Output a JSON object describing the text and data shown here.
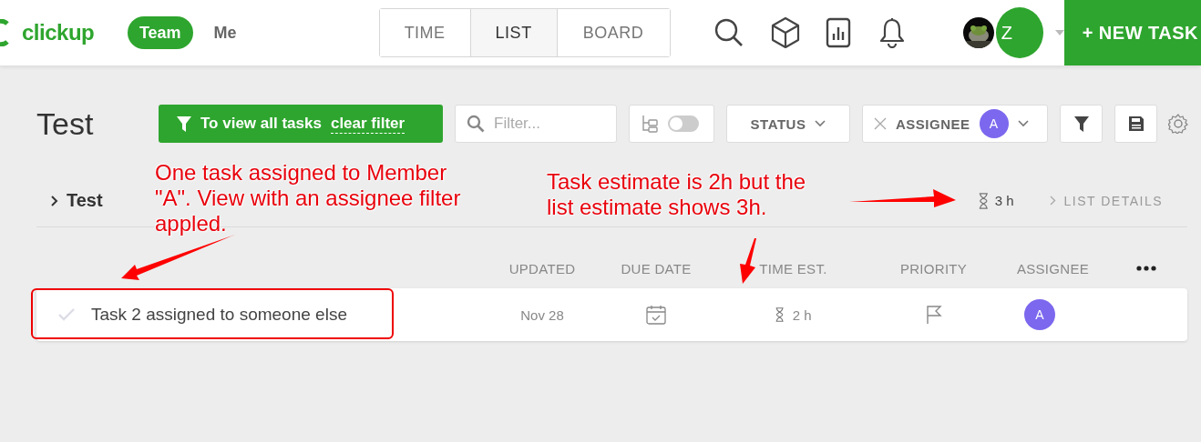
{
  "header": {
    "logo": "clickup",
    "scope_tabs": [
      {
        "label": "Team",
        "selected": true
      },
      {
        "label": "Me",
        "selected": false
      }
    ],
    "view_tabs": [
      {
        "label": "TIME",
        "selected": false
      },
      {
        "label": "LIST",
        "selected": true
      },
      {
        "label": "BOARD",
        "selected": false
      }
    ],
    "user_initial": "Z",
    "new_task_button": "+ NEW TASK"
  },
  "toolbar": {
    "title": "Test",
    "filter_notice": {
      "text": "To view all tasks",
      "link": "clear filter"
    },
    "search": {
      "placeholder": "Filter..."
    },
    "subtasks_toggle": {
      "on": false
    },
    "status_dropdown": "STATUS",
    "assignee_filter": {
      "label": "ASSIGNEE",
      "avatar": "A"
    }
  },
  "list_header": {
    "name": "Test",
    "expanded": false,
    "estimate": "3 h",
    "details_link": "LIST DETAILS"
  },
  "table": {
    "columns": [
      "UPDATED",
      "DUE DATE",
      "TIME EST.",
      "PRIORITY",
      "ASSIGNEE"
    ],
    "rows": [
      {
        "name": "Task 2 assigned to someone else",
        "done": false,
        "updated": "Nov 28",
        "time_est": "2 h",
        "assignee": "A"
      }
    ]
  },
  "annotations": [
    {
      "text": "One task assigned to Member \"A\". View with an assignee filter appled."
    },
    {
      "text": "Task estimate is 2h but the list estimate shows 3h."
    }
  ]
}
